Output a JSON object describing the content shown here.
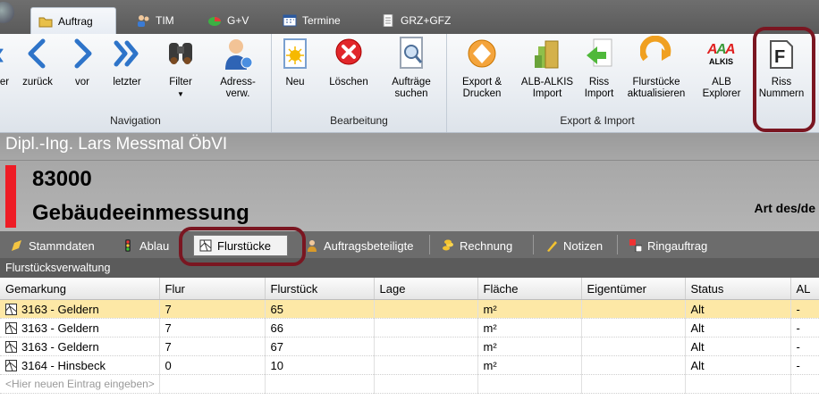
{
  "tabs": [
    {
      "label": "Auftrag",
      "active": true
    },
    {
      "label": "TIM",
      "active": false
    },
    {
      "label": "G+V",
      "active": false
    },
    {
      "label": "Termine",
      "active": false
    },
    {
      "label": "GRZ+GFZ",
      "active": false
    }
  ],
  "ribbon": {
    "navigation": {
      "label": "Navigation",
      "buttons": [
        {
          "label": "er"
        },
        {
          "label": "zurück"
        },
        {
          "label": "vor"
        },
        {
          "label": "letzter"
        },
        {
          "label": "Filter"
        },
        {
          "label": "Adress-\nverw."
        }
      ]
    },
    "bearbeitung": {
      "label": "Bearbeitung",
      "buttons": [
        {
          "label": "Neu"
        },
        {
          "label": "Löschen"
        },
        {
          "label": "Aufträge\nsuchen"
        }
      ]
    },
    "export": {
      "label": "Export & Import",
      "buttons": [
        {
          "label": "Export &\nDrucken"
        },
        {
          "label": "ALB-ALKIS\nImport"
        },
        {
          "label": "Riss\nImport"
        },
        {
          "label": "Flurstücke\naktualisieren"
        },
        {
          "label": "ALB\nExplorer"
        },
        {
          "label": "Riss\nNummern"
        }
      ]
    },
    "alkis_logo_text": "ALKIS"
  },
  "header": {
    "owner": "Dipl.-Ing. Lars Messmal ÖbVI",
    "order_number": "83000",
    "order_type": "Gebäudeeinmessung",
    "art_label": "Art des/de"
  },
  "subtabs": [
    {
      "label": "Stammdaten",
      "active": false
    },
    {
      "label": "Ablau",
      "active": false
    },
    {
      "label": "Flurstücke",
      "active": true
    },
    {
      "label": "Auftragsbeteiligte",
      "active": false
    },
    {
      "label": "Rechnung",
      "active": false
    },
    {
      "label": "Notizen",
      "active": false
    },
    {
      "label": "Ringauftrag",
      "active": false
    }
  ],
  "list_title": "Flurstücksverwaltung",
  "grid": {
    "columns": [
      "Gemarkung",
      "Flur",
      "Flurstück",
      "Lage",
      "Fläche",
      "Eigentümer",
      "Status",
      "AL"
    ],
    "rows": [
      {
        "gemarkung": "3163 - Geldern",
        "flur": "7",
        "flurstueck": "65",
        "lage": "",
        "flaeche": "m²",
        "eigentuemer": "",
        "status": "Alt",
        "al": "-",
        "selected": true
      },
      {
        "gemarkung": "3163 - Geldern",
        "flur": "7",
        "flurstueck": "66",
        "lage": "",
        "flaeche": "m²",
        "eigentuemer": "",
        "status": "Alt",
        "al": "-",
        "selected": false
      },
      {
        "gemarkung": "3163 - Geldern",
        "flur": "7",
        "flurstueck": "67",
        "lage": "",
        "flaeche": "m²",
        "eigentuemer": "",
        "status": "Alt",
        "al": "-",
        "selected": false
      },
      {
        "gemarkung": "3164 - Hinsbeck",
        "flur": "0",
        "flurstueck": "10",
        "lage": "",
        "flaeche": "m²",
        "eigentuemer": "",
        "status": "Alt",
        "al": "-",
        "selected": false
      }
    ],
    "new_row_placeholder": "<Hier neuen Eintrag eingeben>"
  },
  "colors": {
    "selected_row": "#fde8a6",
    "highlight_ring": "#7a1621",
    "order_bar": "#ee1c25",
    "nav_arrow": "#2e74c9"
  }
}
